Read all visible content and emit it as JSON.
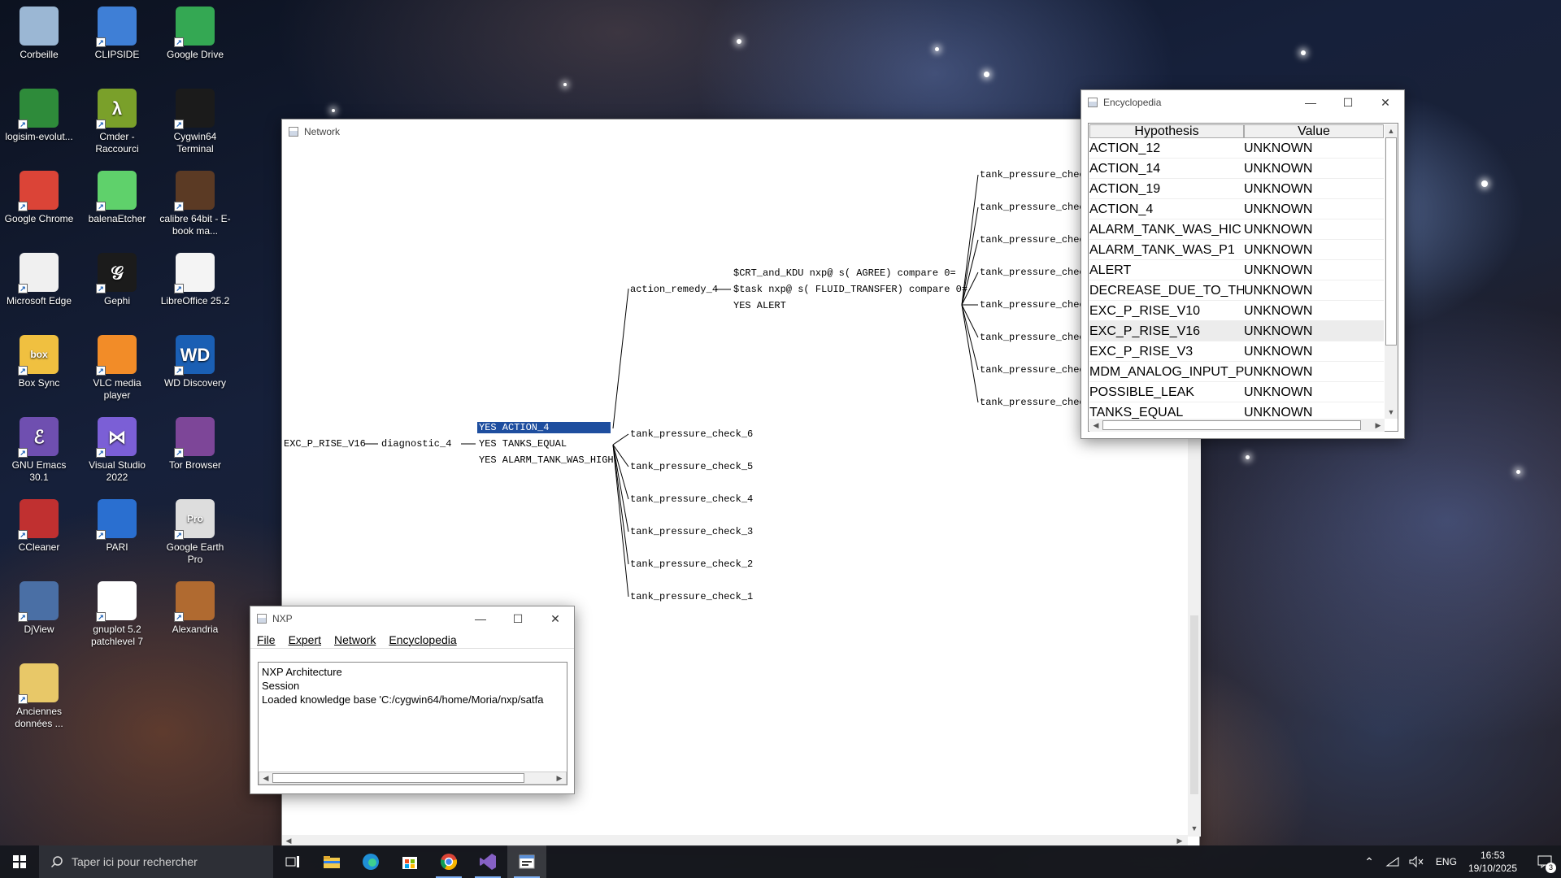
{
  "desktop": {
    "icons": [
      {
        "label": "Corbeille",
        "icon": "recycle-bin-icon"
      },
      {
        "label": "CLIPSIDE",
        "icon": "document-icon"
      },
      {
        "label": "Google Drive",
        "icon": "google-drive-icon"
      },
      {
        "label": "logisim-evolut...",
        "icon": "logisim-icon"
      },
      {
        "label": "Cmder - Raccourci",
        "icon": "cmder-icon"
      },
      {
        "label": "Cygwin64 Terminal",
        "icon": "cygwin-icon"
      },
      {
        "label": "Google Chrome",
        "icon": "chrome-icon"
      },
      {
        "label": "balenaEtcher",
        "icon": "balena-icon"
      },
      {
        "label": "calibre 64bit - E-book ma...",
        "icon": "calibre-icon"
      },
      {
        "label": "Microsoft Edge",
        "icon": "edge-icon"
      },
      {
        "label": "Gephi",
        "icon": "gephi-icon"
      },
      {
        "label": "LibreOffice 25.2",
        "icon": "libreoffice-icon"
      },
      {
        "label": "Box Sync",
        "icon": "box-icon"
      },
      {
        "label": "VLC media player",
        "icon": "vlc-icon"
      },
      {
        "label": "WD Discovery",
        "icon": "wd-icon"
      },
      {
        "label": "GNU Emacs 30.1",
        "icon": "emacs-icon"
      },
      {
        "label": "Visual Studio 2022",
        "icon": "visual-studio-icon"
      },
      {
        "label": "Tor Browser",
        "icon": "tor-icon"
      },
      {
        "label": "CCleaner",
        "icon": "ccleaner-icon"
      },
      {
        "label": "PARI",
        "icon": "pari-icon"
      },
      {
        "label": "Google Earth Pro",
        "icon": "google-earth-icon"
      },
      {
        "label": "DjView",
        "icon": "djview-icon"
      },
      {
        "label": "gnuplot 5.2 patchlevel 7",
        "icon": "gnuplot-icon"
      },
      {
        "label": "Alexandria",
        "icon": "alexandria-icon"
      },
      {
        "label": "Anciennes données ...",
        "icon": "folder-icon"
      }
    ],
    "icon_glyphs": {
      "Box Sync": "box",
      "Visual Studio 2022": "⋈",
      "GNU Emacs 30.1": "ℰ",
      "Gephi": "𝒢",
      "Cmder - Raccourci": "λ",
      "WD Discovery": "WD",
      "Google Earth Pro": "Pro"
    }
  },
  "network": {
    "title": "Network",
    "root": "EXC_P_RISE_V16",
    "node": "diagnostic_4",
    "conditions": [
      "YES ACTION_4",
      "YES TANKS_EQUAL",
      "YES ALARM_TANK_WAS_HIGH"
    ],
    "action": "action_remedy_4",
    "action_details": [
      "$CRT_and_KDU nxp@ s( AGREE) compare 0=",
      "$task nxp@ s( FLUID_TRANSFER) compare 0=",
      "YES ALERT"
    ],
    "right_leaves": [
      "tank_pressure_chec",
      "tank_pressure_chec",
      "tank_pressure_chec",
      "tank_pressure_chec",
      "tank_pressure_chec",
      "tank_pressure_chec",
      "tank_pressure_chec",
      "tank_pressure_chec"
    ],
    "checks": [
      "tank_pressure_check_6",
      "tank_pressure_check_5",
      "tank_pressure_check_4",
      "tank_pressure_check_3",
      "tank_pressure_check_2",
      "tank_pressure_check_1"
    ]
  },
  "encyclopedia": {
    "title": "Encyclopedia",
    "columns": [
      "Hypothesis",
      "Value"
    ],
    "rows": [
      {
        "hypothesis": "ACTION_12",
        "value": "UNKNOWN"
      },
      {
        "hypothesis": "ACTION_14",
        "value": "UNKNOWN"
      },
      {
        "hypothesis": "ACTION_19",
        "value": "UNKNOWN"
      },
      {
        "hypothesis": "ACTION_4",
        "value": "UNKNOWN"
      },
      {
        "hypothesis": "ALARM_TANK_WAS_HIC",
        "value": "UNKNOWN"
      },
      {
        "hypothesis": "ALARM_TANK_WAS_P1",
        "value": "UNKNOWN"
      },
      {
        "hypothesis": "ALERT",
        "value": "UNKNOWN"
      },
      {
        "hypothesis": "DECREASE_DUE_TO_TH",
        "value": "UNKNOWN"
      },
      {
        "hypothesis": "EXC_P_RISE_V10",
        "value": "UNKNOWN"
      },
      {
        "hypothesis": "EXC_P_RISE_V16",
        "value": "UNKNOWN"
      },
      {
        "hypothesis": "EXC_P_RISE_V3",
        "value": "UNKNOWN"
      },
      {
        "hypothesis": "MDM_ANALOG_INPUT_P",
        "value": "UNKNOWN"
      },
      {
        "hypothesis": "POSSIBLE_LEAK",
        "value": "UNKNOWN"
      },
      {
        "hypothesis": "TANKS_EQUAL",
        "value": "UNKNOWN"
      }
    ]
  },
  "nxp": {
    "title": "NXP",
    "menu": [
      "File",
      "Expert",
      "Network",
      "Encyclopedia"
    ],
    "log": [
      "NXP Architecture",
      "Session",
      "Loaded knowledge base 'C:/cygwin64/home/Moria/nxp/satfa"
    ]
  },
  "taskbar": {
    "search_placeholder": "Taper ici pour rechercher",
    "language": "ENG",
    "time": "16:53",
    "date": "19/10/2025",
    "notification_count": "3"
  }
}
